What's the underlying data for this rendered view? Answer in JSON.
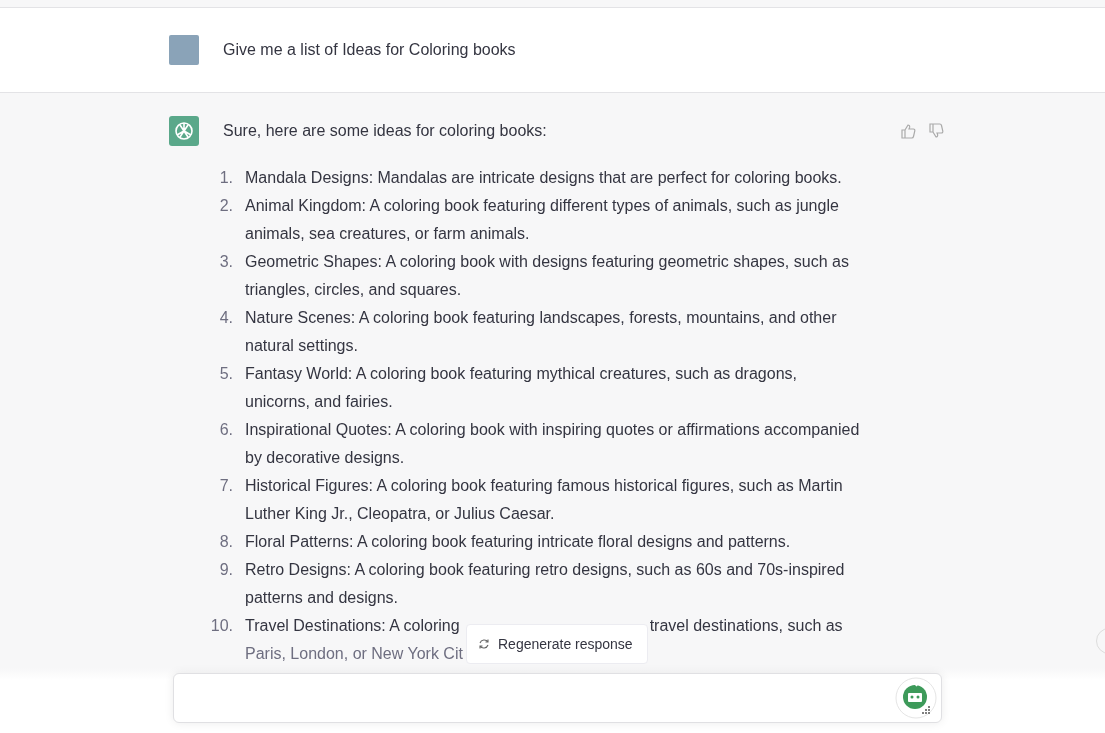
{
  "user_message": {
    "text": "Give me a list of Ideas for Coloring books"
  },
  "assistant_message": {
    "intro": "Sure, here are some ideas for coloring books:",
    "items": [
      {
        "number": "1.",
        "text": "Mandala Designs: Mandalas are intricate designs that are perfect for coloring books."
      },
      {
        "number": "2.",
        "text": "Animal Kingdom: A coloring book featuring different types of animals, such as jungle animals, sea creatures, or farm animals."
      },
      {
        "number": "3.",
        "text": "Geometric Shapes: A coloring book with designs featuring geometric shapes, such as triangles, circles, and squares."
      },
      {
        "number": "4.",
        "text": "Nature Scenes: A coloring book featuring landscapes, forests, mountains, and other natural settings."
      },
      {
        "number": "5.",
        "text": "Fantasy World: A coloring book featuring mythical creatures, such as dragons, unicorns, and fairies."
      },
      {
        "number": "6.",
        "text": "Inspirational Quotes: A coloring book with inspiring quotes or affirmations accompanied by decorative designs."
      },
      {
        "number": "7.",
        "text": "Historical Figures: A coloring book featuring famous historical figures, such as Martin Luther King Jr., Cleopatra, or Julius Caesar."
      },
      {
        "number": "8.",
        "text": "Floral Patterns: A coloring book featuring intricate floral designs and patterns."
      },
      {
        "number": "9.",
        "text": "Retro Designs: A coloring book featuring retro designs, such as 60s and 70s-inspired patterns and designs."
      },
      {
        "number": "10.",
        "text_parts": [
          "Travel Destinations: A coloring",
          "travel destinations, such as",
          "Paris, London, or New York Cit"
        ]
      }
    ]
  },
  "regenerate_button": {
    "label": "Regenerate response"
  }
}
